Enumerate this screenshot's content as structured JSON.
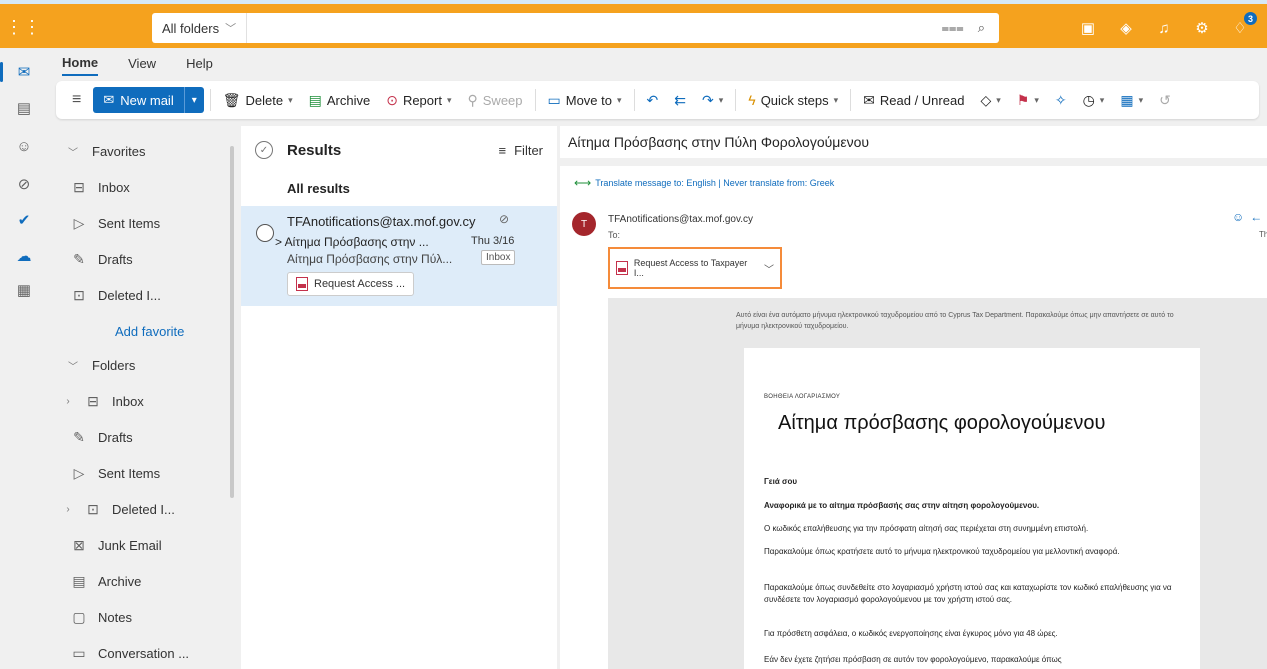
{
  "topbar": {
    "search_scope": "All folders",
    "search_placeholder": "",
    "premium_badge": "3",
    "icons": [
      "waffle-icon",
      "filter-icon",
      "search-icon",
      "word-icon",
      "teams-icon",
      "bell-icon",
      "gear-icon",
      "premium-icon"
    ]
  },
  "tabs": [
    "Home",
    "View",
    "Help"
  ],
  "ribbon": {
    "new_mail": "New mail",
    "delete": "Delete",
    "archive": "Archive",
    "report": "Report",
    "sweep": "Sweep",
    "move_to": "Move to",
    "quick_steps": "Quick steps",
    "read_unread": "Read / Unread"
  },
  "folderpane": {
    "favorites_head": "Favorites",
    "favorites": [
      "Inbox",
      "Sent Items",
      "Drafts",
      "Deleted I..."
    ],
    "add_favorite": "Add favorite",
    "folders_head": "Folders",
    "folders": [
      "Inbox",
      "Drafts",
      "Sent Items",
      "Deleted I...",
      "Junk Email",
      "Archive",
      "Notes",
      "Conversation ..."
    ]
  },
  "msglist": {
    "title": "Results",
    "filter": "Filter",
    "subheader": "All results",
    "item": {
      "from": "TFAnotifications@tax.mof.gov.cy",
      "subject": "> Αίτημα Πρόσβασης στην ...",
      "date": "Thu 3/16",
      "preview": "Αίτημα Πρόσβασης στην Πύλ...",
      "folder_tag": "Inbox",
      "attachment": "Request Access ..."
    }
  },
  "reading": {
    "subject": "Αίτημα Πρόσβασης στην Πύλη Φορολογούμενου",
    "translate": "Translate message to: English | Never translate from: Greek",
    "avatar_letter": "T",
    "sender": "TFAnotifications@tax.mof.gov.cy",
    "to_label": "To:",
    "right_sub": "Th",
    "attachment": "Request Access to Taxpayer I...",
    "auto_note": "Αυτό είναι ένα αυτόματο μήνυμα ηλεκτρονικού ταχυδρομείου από το Cyprus Tax Department. Παρακαλούμε όπως μην απαντήσετε σε αυτό το μήνυμα ηλεκτρονικού ταχυδρομείου.",
    "card": {
      "kicker": "ΒΟΗΘΕΙΑ ΛΟΓΑΡΙΑΣΜΟΥ",
      "heading": "Αίτημα πρόσβασης φορολογούμενου",
      "greeting": "Γειά σου",
      "bold_line": "Αναφορικά με το αίτημα πρόσβασής σας στην αίτηση φορολογούμενου.",
      "p1": "Ο κωδικός επαλήθευσης για την πρόσφατη αίτησή σας περιέχεται στη συνημμένη επιστολή.",
      "p2": "Παρακαλούμε όπως κρατήσετε αυτό το μήνυμα ηλεκτρονικού ταχυδρομείου για μελλοντική αναφορά.",
      "p3": "Παρακαλούμε όπως συνδεθείτε στο λογαριασμό χρήστη ιστού σας και καταχωρίστε τον κωδικό επαλήθευσης για να συνδέσετε τον λογαριασμό φορολογούμενου με τον χρήστη ιστού σας.",
      "p4": "Για πρόσθετη ασφάλεια, ο κωδικός ενεργοποίησης είναι έγκυρος μόνο για 48 ώρες.",
      "p5": "Εάν δεν έχετε ζητήσει πρόσβαση σε αυτόν τον φορολογούμενο, παρακαλούμε όπως"
    }
  },
  "colors": {
    "brand_bar": "#f5a21e",
    "accent": "#0f6cbd",
    "highlight_box": "#f58b3a",
    "selected_row": "#deecf9"
  }
}
